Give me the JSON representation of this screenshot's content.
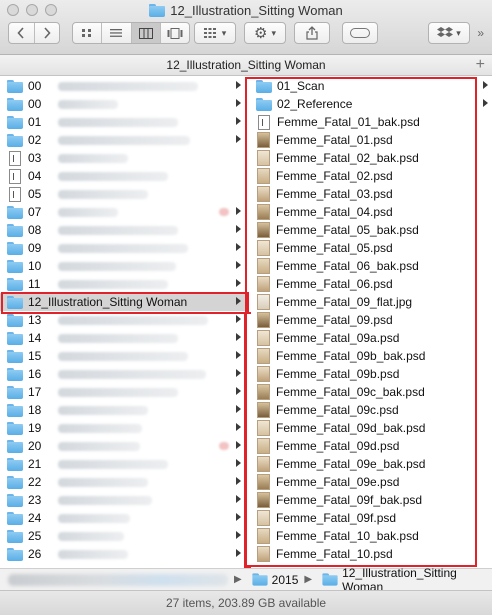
{
  "window": {
    "title": "12_Illustration_Sitting Woman"
  },
  "toolbar": {
    "back_icon": "chevron-left",
    "forward_icon": "chevron-right",
    "views": [
      "icon-view",
      "list-view",
      "column-view",
      "cover-flow-view"
    ],
    "active_view": "column-view",
    "arrange_icon": "arrange-grid",
    "action_icon": "gear",
    "share_icon": "share",
    "tag_icon": "tag",
    "dropbox_icon": "dropbox",
    "more_label": "»"
  },
  "path_header": {
    "title": "12_Illustration_Sitting Woman",
    "add_label": "+"
  },
  "column1": {
    "items": [
      {
        "label": "00",
        "icon": "folder"
      },
      {
        "label": "00",
        "icon": "folder"
      },
      {
        "label": "01",
        "icon": "folder"
      },
      {
        "label": "02",
        "icon": "folder"
      },
      {
        "label": "03",
        "icon": "document"
      },
      {
        "label": "04",
        "icon": "document"
      },
      {
        "label": "05",
        "icon": "document"
      },
      {
        "label": "07",
        "icon": "folder"
      },
      {
        "label": "08",
        "icon": "folder"
      },
      {
        "label": "09",
        "icon": "folder"
      },
      {
        "label": "10",
        "icon": "folder"
      },
      {
        "label": "11",
        "icon": "folder"
      },
      {
        "label": "12_Illustration_Sitting Woman",
        "icon": "folder",
        "selected": true
      },
      {
        "label": "13",
        "icon": "folder"
      },
      {
        "label": "14",
        "icon": "folder"
      },
      {
        "label": "15",
        "icon": "folder"
      },
      {
        "label": "16",
        "icon": "folder"
      },
      {
        "label": "17",
        "icon": "folder"
      },
      {
        "label": "18",
        "icon": "folder"
      },
      {
        "label": "19",
        "icon": "folder"
      },
      {
        "label": "20",
        "icon": "folder"
      },
      {
        "label": "21",
        "icon": "folder"
      },
      {
        "label": "22",
        "icon": "folder"
      },
      {
        "label": "23",
        "icon": "folder"
      },
      {
        "label": "24",
        "icon": "folder"
      },
      {
        "label": "25",
        "icon": "folder"
      },
      {
        "label": "26",
        "icon": "folder"
      }
    ]
  },
  "column2": {
    "items": [
      {
        "label": "01_Scan",
        "icon": "folder"
      },
      {
        "label": "02_Reference",
        "icon": "folder"
      },
      {
        "label": "Femme_Fatal_01_bak.psd",
        "icon": "psd-blank"
      },
      {
        "label": "Femme_Fatal_01.psd",
        "icon": "psd-thumb"
      },
      {
        "label": "Femme_Fatal_02_bak.psd",
        "icon": "psd-thumb"
      },
      {
        "label": "Femme_Fatal_02.psd",
        "icon": "psd-thumb"
      },
      {
        "label": "Femme_Fatal_03.psd",
        "icon": "psd-thumb"
      },
      {
        "label": "Femme_Fatal_04.psd",
        "icon": "psd-thumb"
      },
      {
        "label": "Femme_Fatal_05_bak.psd",
        "icon": "psd-thumb"
      },
      {
        "label": "Femme_Fatal_05.psd",
        "icon": "psd-thumb"
      },
      {
        "label": "Femme_Fatal_06_bak.psd",
        "icon": "psd-thumb"
      },
      {
        "label": "Femme_Fatal_06.psd",
        "icon": "psd-thumb"
      },
      {
        "label": "Femme_Fatal_09_flat.jpg",
        "icon": "jpg-thumb"
      },
      {
        "label": "Femme_Fatal_09.psd",
        "icon": "psd-thumb"
      },
      {
        "label": "Femme_Fatal_09a.psd",
        "icon": "psd-thumb"
      },
      {
        "label": "Femme_Fatal_09b_bak.psd",
        "icon": "psd-thumb"
      },
      {
        "label": "Femme_Fatal_09b.psd",
        "icon": "psd-thumb"
      },
      {
        "label": "Femme_Fatal_09c_bak.psd",
        "icon": "psd-thumb"
      },
      {
        "label": "Femme_Fatal_09c.psd",
        "icon": "psd-thumb"
      },
      {
        "label": "Femme_Fatal_09d_bak.psd",
        "icon": "psd-thumb"
      },
      {
        "label": "Femme_Fatal_09d.psd",
        "icon": "psd-thumb"
      },
      {
        "label": "Femme_Fatal_09e_bak.psd",
        "icon": "psd-thumb"
      },
      {
        "label": "Femme_Fatal_09e.psd",
        "icon": "psd-thumb"
      },
      {
        "label": "Femme_Fatal_09f_bak.psd",
        "icon": "psd-thumb"
      },
      {
        "label": "Femme_Fatal_09f.psd",
        "icon": "psd-thumb"
      },
      {
        "label": "Femme_Fatal_10_bak.psd",
        "icon": "psd-thumb"
      },
      {
        "label": "Femme_Fatal_10.psd",
        "icon": "psd-thumb"
      }
    ]
  },
  "path_bar": {
    "crumbs": [
      "2015",
      "12_Illustration_Sitting Woman"
    ]
  },
  "status_bar": {
    "text": "27 items, 203.89 GB available"
  },
  "colors": {
    "highlight_box": "#e0222a",
    "folder_blue": "#59aee6",
    "selection_gray": "#d4d4d4"
  }
}
